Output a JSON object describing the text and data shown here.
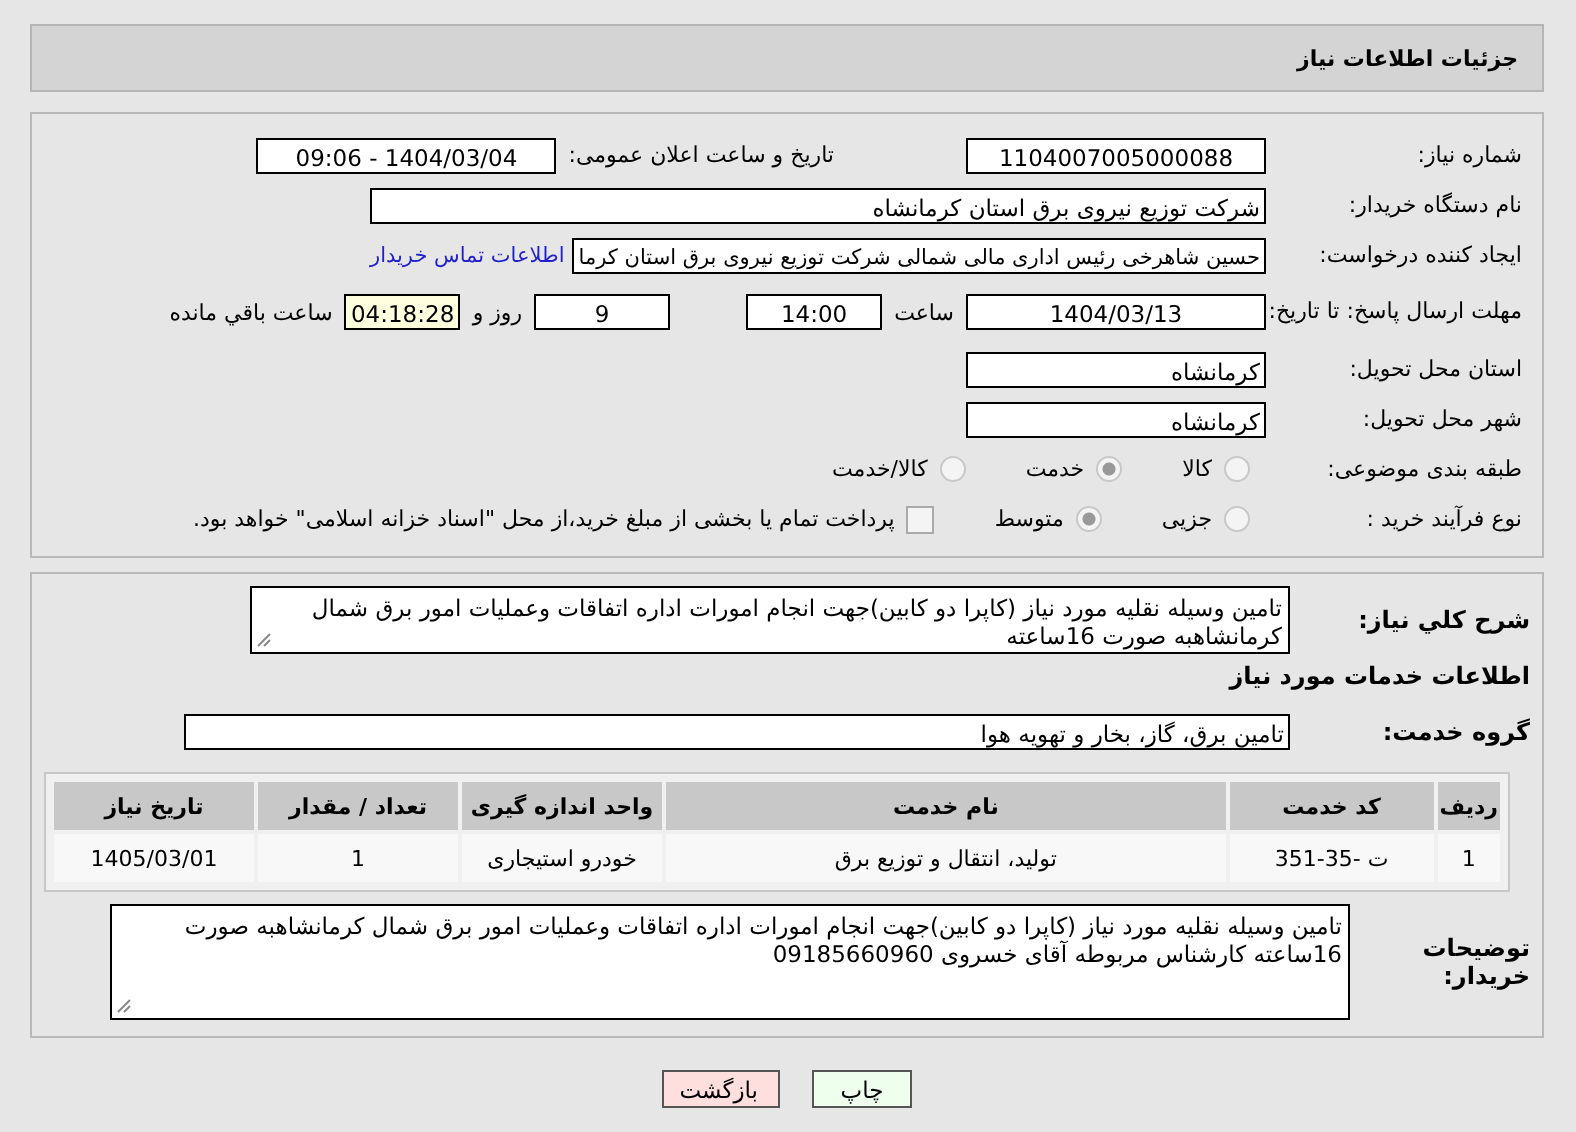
{
  "header": {
    "title": "جزئیات اطلاعات نیاز"
  },
  "need_number": {
    "label": "شماره نیاز:",
    "value": "1104007005000088"
  },
  "announce": {
    "label": "تاریخ و ساعت اعلان عمومی:",
    "value": "1404/03/04 - 09:06"
  },
  "buyer": {
    "label": "نام دستگاه خریدار:",
    "value": "شرکت توزیع نیروی برق استان کرمانشاه"
  },
  "creator": {
    "label": "ایجاد کننده درخواست:",
    "value": "حسین شاهرخی رئیس اداری مالی شمالی شرکت توزیع نیروی برق استان کرما",
    "link": "اطلاعات تماس خریدار"
  },
  "deadline": {
    "label": "مهلت ارسال پاسخ: تا تاریخ:",
    "date": "1404/03/13",
    "time_label": "ساعت",
    "time": "14:00",
    "days": "9",
    "days_label": "روز و",
    "remaining": "04:18:28",
    "remaining_label": "ساعت باقي مانده"
  },
  "province": {
    "label": "استان محل تحویل:",
    "value": "کرمانشاه"
  },
  "city": {
    "label": "شهر محل تحویل:",
    "value": "کرمانشاه"
  },
  "category": {
    "label": "طبقه بندی موضوعی:",
    "options": [
      {
        "label": "کالا",
        "selected": false
      },
      {
        "label": "خدمت",
        "selected": true
      },
      {
        "label": "کالا/خدمت",
        "selected": false
      }
    ]
  },
  "purchase_type": {
    "label": "نوع فرآیند خرید :",
    "options": [
      {
        "label": "جزیی",
        "selected": false
      },
      {
        "label": "متوسط",
        "selected": true
      }
    ],
    "payment": {
      "checked": false,
      "text": "پرداخت تمام یا بخشی از مبلغ خرید،از محل \"اسناد خزانه اسلامی\" خواهد بود."
    }
  },
  "description": {
    "label": "شرح کلي نياز:",
    "value": "تامین وسیله نقلیه مورد نیاز (کاپرا دو کابین)جهت انجام امورات اداره اتفاقات وعملیات امور برق شمال کرمانشاهبه صورت 16ساعته"
  },
  "services_heading": "اطلاعات خدمات مورد نیاز",
  "service_group": {
    "label": "گروه خدمت:",
    "value": "تامین برق، گاز، بخار و تهویه هوا"
  },
  "table": {
    "columns": [
      "ردیف",
      "کد خدمت",
      "نام خدمت",
      "واحد اندازه گیری",
      "تعداد / مقدار",
      "تاریخ نیاز"
    ],
    "rows": [
      [
        "1",
        "ت -35-351",
        "تولید، انتقال و توزیع برق",
        "خودرو استیجاری",
        "1",
        "1405/03/01"
      ]
    ]
  },
  "notes": {
    "label": "توضیحات خریدار:",
    "value": "تامین وسیله نقلیه مورد نیاز (کاپرا دو کابین)جهت انجام امورات اداره اتفاقات وعملیات امور برق شمال کرمانشاهبه صورت 16ساعته کارشناس مربوطه آقای خسروی 09185660960"
  },
  "buttons": [
    {
      "label": "چاپ",
      "kind": "print"
    },
    {
      "label": "بازگشت",
      "kind": "back"
    }
  ]
}
